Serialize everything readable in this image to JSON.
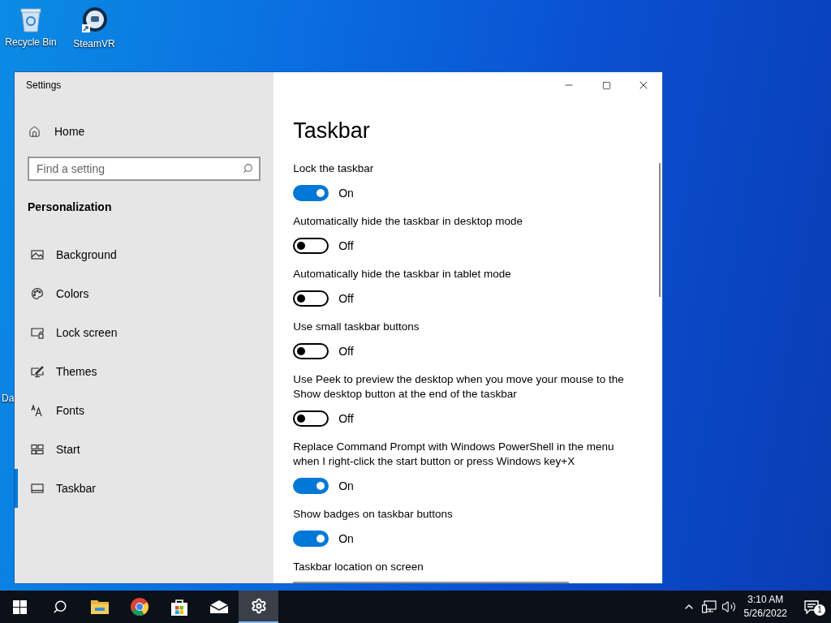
{
  "desktop": {
    "icons": [
      {
        "kind": "recycle-bin",
        "label": "Recycle Bin"
      },
      {
        "kind": "steamvr",
        "label": "SteamVR"
      }
    ],
    "partial_label": "Da"
  },
  "window": {
    "title": "Settings",
    "sidebar": {
      "home": "Home",
      "search": {
        "placeholder": "Find a setting"
      },
      "section": "Personalization",
      "items": [
        {
          "kind": "background",
          "label": "Background",
          "selected": false
        },
        {
          "kind": "colors",
          "label": "Colors",
          "selected": false
        },
        {
          "kind": "lock",
          "label": "Lock screen",
          "selected": false
        },
        {
          "kind": "themes",
          "label": "Themes",
          "selected": false
        },
        {
          "kind": "fonts",
          "label": "Fonts",
          "selected": false
        },
        {
          "kind": "start",
          "label": "Start",
          "selected": false
        },
        {
          "kind": "taskbar",
          "label": "Taskbar",
          "selected": true
        }
      ]
    },
    "page": {
      "title": "Taskbar",
      "settings": [
        {
          "label": "Lock the taskbar",
          "on": true,
          "state_text": "On"
        },
        {
          "label": "Automatically hide the taskbar in desktop mode",
          "on": false,
          "state_text": "Off"
        },
        {
          "label": "Automatically hide the taskbar in tablet mode",
          "on": false,
          "state_text": "Off"
        },
        {
          "label": "Use small taskbar buttons",
          "on": false,
          "state_text": "Off"
        },
        {
          "label": "Use Peek to preview the desktop when you move your mouse to the Show desktop button at the end of the taskbar",
          "on": false,
          "state_text": "Off"
        },
        {
          "label": "Replace Command Prompt with Windows PowerShell in the menu when I right-click the start button or press Windows key+X",
          "on": true,
          "state_text": "On"
        },
        {
          "label": "Show badges on taskbar buttons",
          "on": true,
          "state_text": "On"
        }
      ],
      "location_label": "Taskbar location on screen"
    }
  },
  "taskbar": {
    "apps": [
      {
        "kind": "start",
        "selected": false
      },
      {
        "kind": "search",
        "selected": false
      },
      {
        "kind": "folder",
        "selected": false
      },
      {
        "kind": "chrome",
        "selected": false
      },
      {
        "kind": "store",
        "selected": false
      },
      {
        "kind": "mail",
        "selected": false
      },
      {
        "kind": "settings",
        "selected": true
      }
    ],
    "time": "3:10 AM",
    "date": "5/26/2022",
    "notifications": "1"
  }
}
